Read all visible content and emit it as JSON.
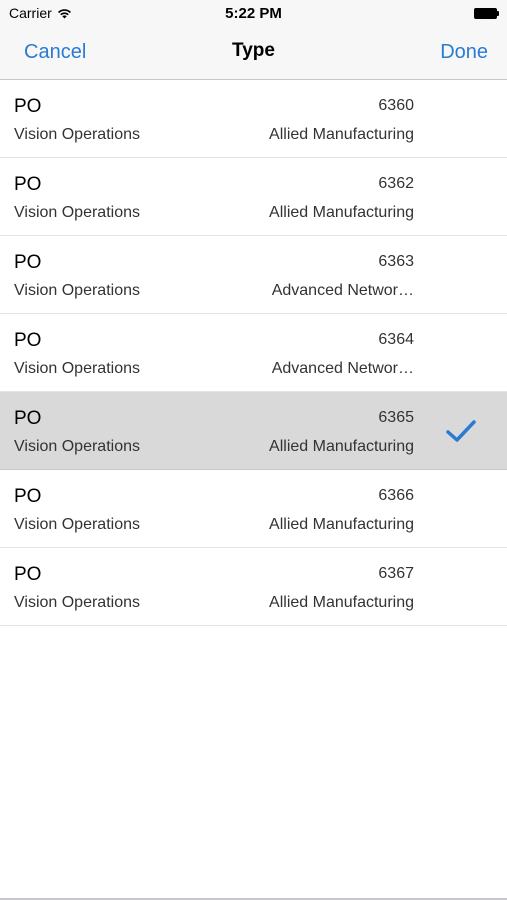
{
  "status_bar": {
    "carrier": "Carrier",
    "time": "5:22 PM"
  },
  "nav": {
    "cancel_label": "Cancel",
    "title": "Type",
    "done_label": "Done"
  },
  "colors": {
    "accent": "#2a7bd1",
    "selected_row_bg": "#d9d9d9"
  },
  "rows": [
    {
      "type": "PO",
      "number": "6360",
      "org": "Vision Operations",
      "supplier": "Allied Manufacturing",
      "selected": false
    },
    {
      "type": "PO",
      "number": "6362",
      "org": "Vision Operations",
      "supplier": "Allied Manufacturing",
      "selected": false
    },
    {
      "type": "PO",
      "number": "6363",
      "org": "Vision Operations",
      "supplier": "Advanced Networ…",
      "selected": false
    },
    {
      "type": "PO",
      "number": "6364",
      "org": "Vision Operations",
      "supplier": "Advanced Networ…",
      "selected": false
    },
    {
      "type": "PO",
      "number": "6365",
      "org": "Vision Operations",
      "supplier": "Allied Manufacturing",
      "selected": true
    },
    {
      "type": "PO",
      "number": "6366",
      "org": "Vision Operations",
      "supplier": "Allied Manufacturing",
      "selected": false
    },
    {
      "type": "PO",
      "number": "6367",
      "org": "Vision Operations",
      "supplier": "Allied Manufacturing",
      "selected": false
    }
  ],
  "icons": {
    "selected_marker": "checkmark-icon",
    "wifi": "wifi-icon",
    "battery": "battery-icon"
  }
}
